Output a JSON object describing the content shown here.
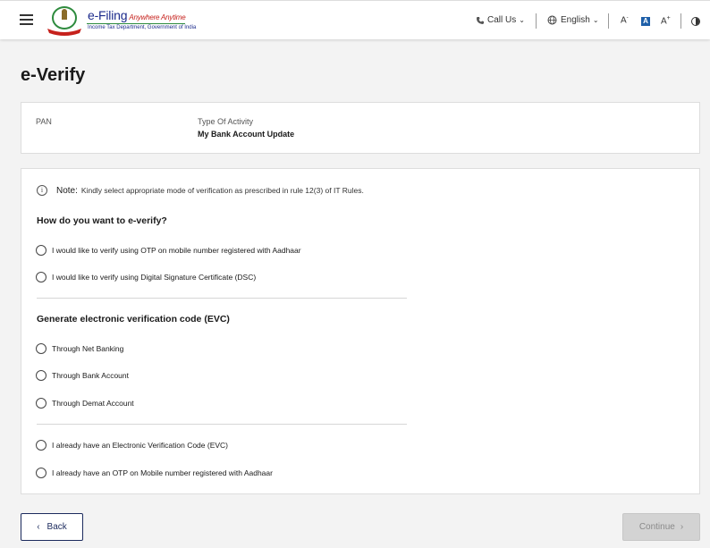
{
  "header": {
    "logo_title": "e-Filing",
    "logo_tagline": "Anywhere Anytime",
    "logo_subtitle": "Income Tax Department, Government of India",
    "call_us": "Call Us",
    "language": "English",
    "font_decrease": "A",
    "font_default": "A",
    "font_increase": "A"
  },
  "page": {
    "title": "e-Verify"
  },
  "info": {
    "pan_label": "PAN",
    "pan_value": "",
    "activity_label": "Type Of Activity",
    "activity_value": "My Bank Account Update"
  },
  "note": {
    "label": "Note:",
    "text": "Kindly select appropriate mode of verification as prescribed in rule 12(3) of IT Rules."
  },
  "sections": {
    "verify_question": "How do you want to e-verify?",
    "evc_heading": "Generate electronic verification code (EVC)"
  },
  "options": {
    "otp_aadhaar": "I would like to verify using OTP on mobile number registered with Aadhaar",
    "dsc": "I would like to verify using Digital Signature Certificate (DSC)",
    "net_banking": "Through Net Banking",
    "bank_account": "Through Bank Account",
    "demat_account": "Through Demat Account",
    "have_evc": "I already have an Electronic Verification Code (EVC)",
    "have_otp": "I already have an OTP on Mobile number registered with Aadhaar"
  },
  "buttons": {
    "back": "Back",
    "continue": "Continue"
  },
  "colors": {
    "brand_blue": "#1c2b8c",
    "brand_red": "#c6211c",
    "accent_active": "#1e5fa8",
    "disabled_button": "#d3d3d3"
  },
  "icons": {
    "menu": "hamburger-menu-icon",
    "phone": "phone-icon",
    "globe": "globe-icon",
    "contrast": "contrast-icon",
    "info": "info-icon"
  }
}
